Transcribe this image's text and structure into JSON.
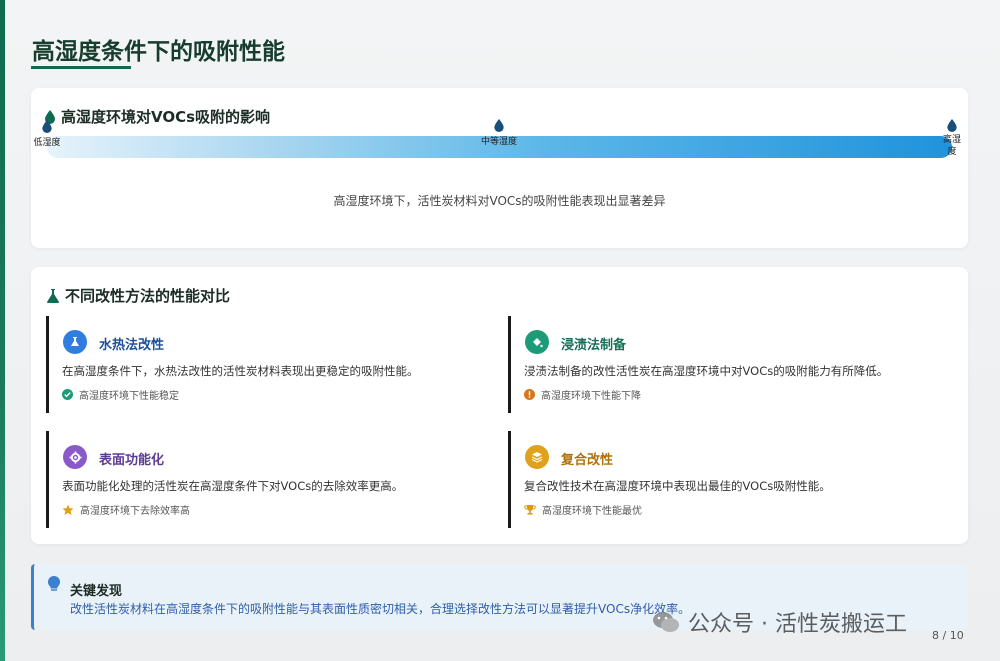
{
  "page": {
    "title": "高湿度条件下的吸附性能",
    "page_number": "8 / 10"
  },
  "humidity": {
    "heading": "高湿度环境对VOCs吸附的影响",
    "markers": {
      "low": "低湿度",
      "mid": "中等湿度",
      "high": "高湿度"
    },
    "caption": "高湿度环境下，活性炭材料对VOCs的吸附性能表现出显著差异"
  },
  "comparison": {
    "heading": "不同改性方法的性能对比",
    "methods": [
      {
        "title": "水热法改性",
        "desc": "在高湿度条件下，水热法改性的活性炭材料表现出更稳定的吸附性能。",
        "note": "高湿度环境下性能稳定",
        "color": "#2f7de0",
        "title_color": "#1d4f9a",
        "icon": "flask-icon",
        "note_icon": "check-circle-icon"
      },
      {
        "title": "浸渍法制备",
        "desc": "浸渍法制备的改性活性炭在高湿度环境中对VOCs的吸附能力有所降低。",
        "note": "高湿度环境下性能下降",
        "color": "#1d9b78",
        "title_color": "#1b6f57",
        "icon": "fill-drip-icon",
        "note_icon": "alert-circle-icon"
      },
      {
        "title": "表面功能化",
        "desc": "表面功能化处理的活性炭在高湿度条件下对VOCs的去除效率更高。",
        "note": "高湿度环境下去除效率高",
        "color": "#8a5ac8",
        "title_color": "#5c3b94",
        "icon": "gear-icon",
        "note_icon": "star-icon"
      },
      {
        "title": "复合改性",
        "desc": "复合改性技术在高湿度环境中表现出最佳的VOCs吸附性能。",
        "note": "高湿度环境下性能最优",
        "color": "#e0a11c",
        "title_color": "#b0700c",
        "icon": "layers-icon",
        "note_icon": "trophy-icon"
      }
    ]
  },
  "finding": {
    "title": "关键发现",
    "text": "改性活性炭材料在高湿度条件下的吸附性能与其表面性质密切相关，合理选择改性方法可以显著提升VOCs净化效率。"
  },
  "watermark": {
    "text": "公众号 · 活性炭搬运工"
  }
}
